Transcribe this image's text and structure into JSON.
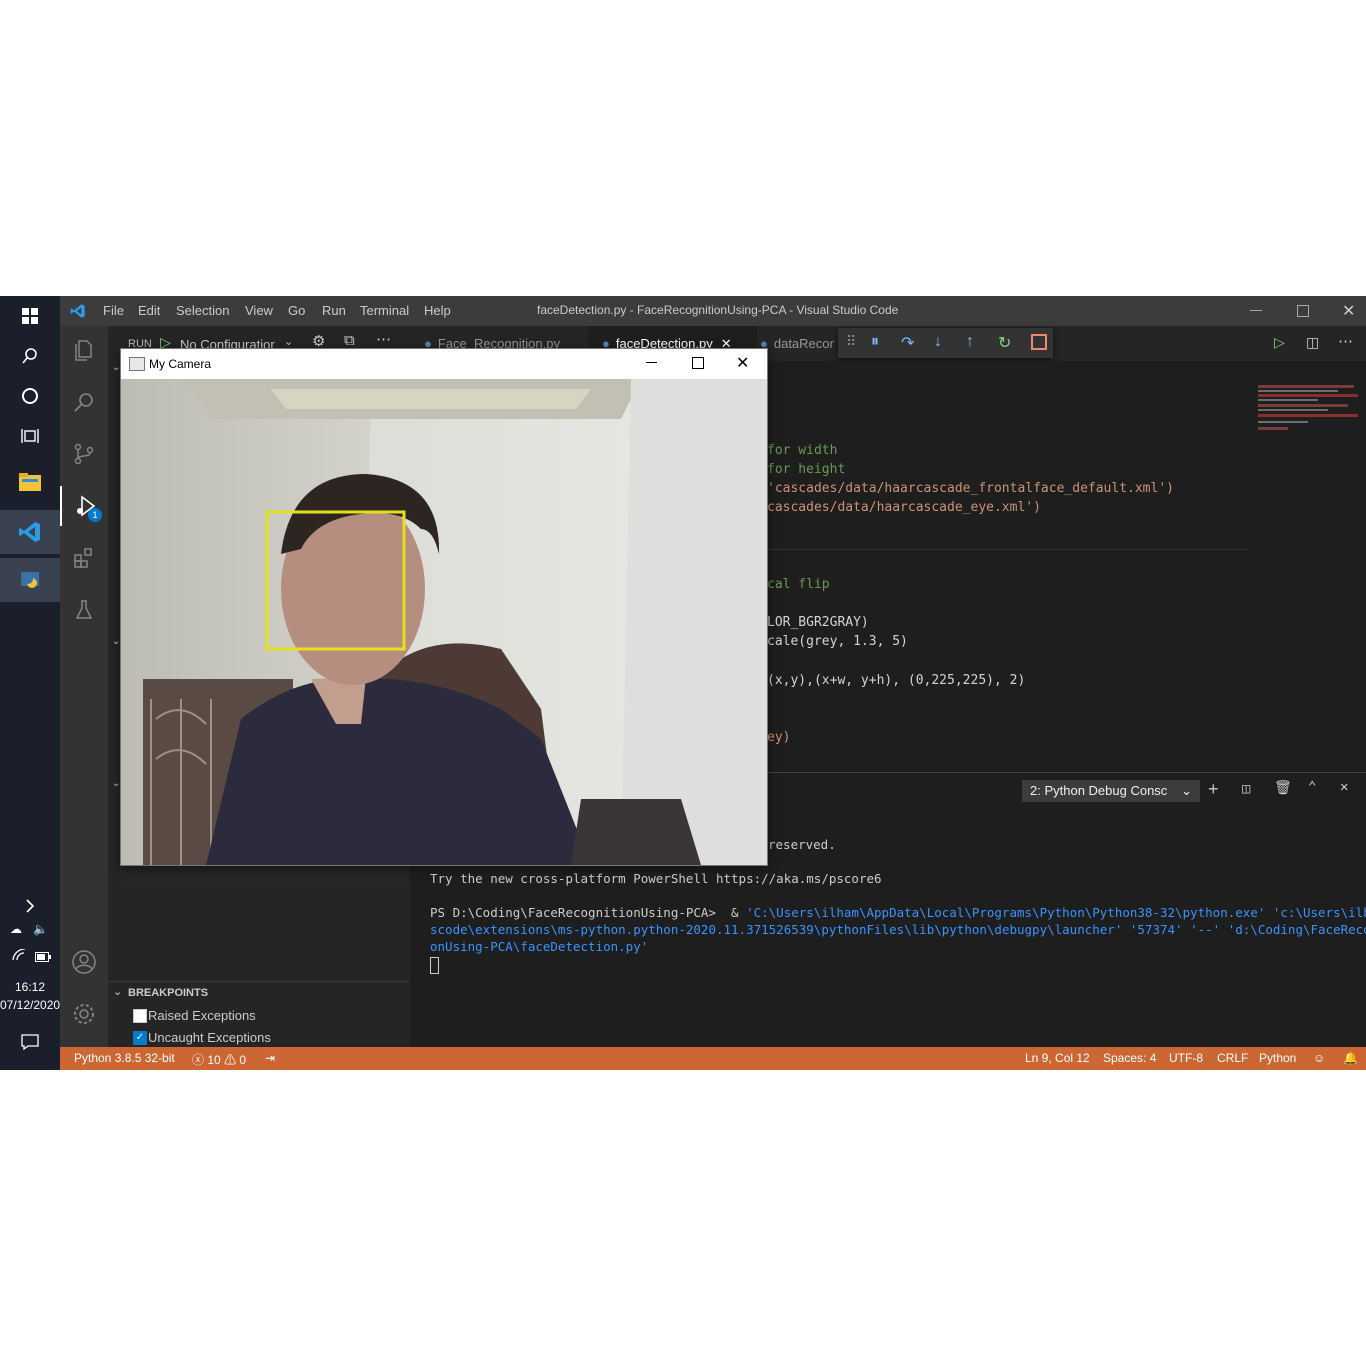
{
  "taskbar": {
    "clock": "16:12",
    "date": "07/12/2020"
  },
  "titlebar": {
    "menus": [
      "File",
      "Edit",
      "Selection",
      "View",
      "Go",
      "Run",
      "Terminal",
      "Help"
    ],
    "title": "faceDetection.py - FaceRecognitionUsing-PCA - Visual Studio Code"
  },
  "sidebar": {
    "run_label": "RUN",
    "config": "No Configuratior",
    "breakpoints_header": "BREAKPOINTS",
    "raised_exceptions": "Raised Exceptions",
    "uncaught_exceptions": "Uncaught Exceptions"
  },
  "activity": {
    "debug_badge": "1"
  },
  "tabs": [
    {
      "label": "Face_Recognition.py"
    },
    {
      "label": "faceDetection.py"
    },
    {
      "label": "dataRecor"
    }
  ],
  "editor_lines": [
    "for width",
    "for height",
    "'cascades/data/haarcascade_frontalface_default.xml')",
    "cascades/data/haarcascade_eye.xml')",
    "cal flip",
    "LOR_BGR2GRAY)",
    "cale(grey, 1.3, 5)",
    "(x,y),(x+w, y+h), (0,225,225), 2)",
    "ey)"
  ],
  "panel": {
    "console_select": "2: Python Debug Consc",
    "lines": [
      "reserved.",
      "Try the new cross-platform PowerShell https://aka.ms/pscore6",
      "PS D:\\Coding\\FaceRecognitionUsing-PCA>  & ",
      "'C:\\Users\\ilham\\AppData\\Local\\Programs\\Python\\Python38-32\\python.exe' 'c:\\Users\\ilham\\.v",
      "scode\\extensions\\ms-python.python-2020.11.371526539\\pythonFiles\\lib\\python\\debugpy\\launcher' '57374' '--' 'd:\\Coding\\FaceRecogniti",
      "onUsing-PCA\\faceDetection.py'"
    ]
  },
  "status": {
    "interpreter": "Python 3.8.5 32-bit",
    "errors": "10",
    "warnings": "0",
    "position": "Ln 9, Col 12",
    "spaces": "Spaces: 4",
    "encoding": "UTF-8",
    "eol": "CRLF",
    "language": "Python"
  },
  "camera_window": {
    "title": "My Camera"
  },
  "colors": {
    "status_bar": "#cc6633",
    "face_box": "#e5e01e",
    "title_bar": "#3c3c3c"
  }
}
